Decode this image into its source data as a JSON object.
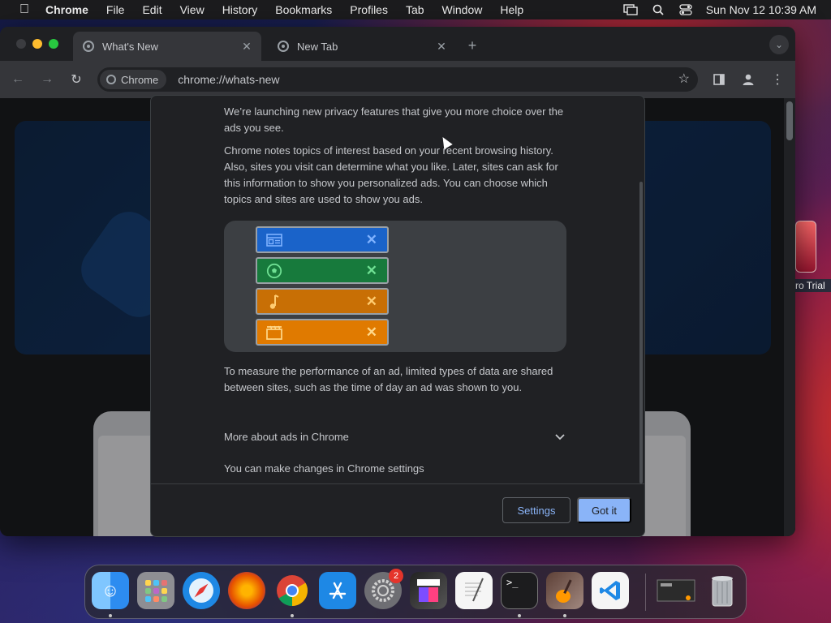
{
  "menubar": {
    "app_name": "Chrome",
    "menus": [
      "File",
      "Edit",
      "View",
      "History",
      "Bookmarks",
      "Profiles",
      "Tab",
      "Window",
      "Help"
    ],
    "clock": "Sun Nov 12  10:39 AM"
  },
  "browser": {
    "tabs": [
      {
        "title": "What's New",
        "active": true
      },
      {
        "title": "New Tab",
        "active": false
      }
    ],
    "site_chip": "Chrome",
    "url": "chrome://whats-new"
  },
  "dialog": {
    "paragraph_1": "We’re launching new privacy features that give you more choice over the ads you see.",
    "paragraph_2": "Chrome notes topics of interest based on your recent browsing history. Also, sites you visit can determine what you like. Later, sites can ask for this information to show you personalized ads. You can choose which topics and sites are used to show you ads.",
    "paragraph_3": "To measure the performance of an ad, limited types of data are shared between sites, such as the time of day an ad was shown to you.",
    "more_about": "More about ads in Chrome",
    "settings_line": "You can make changes in Chrome settings",
    "settings_button": "Settings",
    "got_it_button": "Got it",
    "topics": [
      {
        "icon": "newspaper-icon",
        "color": "#1a63c9"
      },
      {
        "icon": "soccer-ball-icon",
        "color": "#177a3c"
      },
      {
        "icon": "music-note-icon",
        "color": "#c86f05"
      },
      {
        "icon": "clapperboard-icon",
        "color": "#e07a00"
      }
    ]
  },
  "desktop": {
    "icon_label": "ro Trial"
  },
  "dock": {
    "apps": [
      "Finder",
      "Launchpad",
      "Safari",
      "Firefox",
      "Chrome",
      "App Store",
      "System Settings",
      "Final Cut Pro",
      "TextEdit",
      "Terminal",
      "GarageBand",
      "Visual Studio Code",
      "Screenshot",
      "Trash"
    ],
    "settings_badge": "2"
  }
}
